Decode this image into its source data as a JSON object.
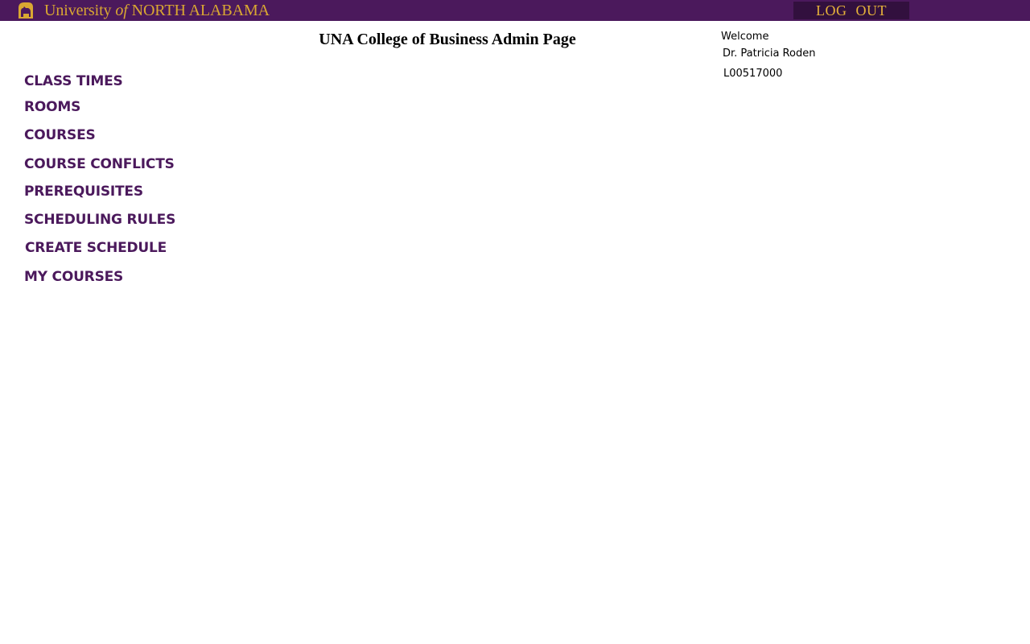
{
  "header": {
    "logo_text_1": "University",
    "logo_text_of": "of",
    "logo_text_2": "NORTH ALABAMA",
    "logo_icon": "lion-icon",
    "logout_label": "LOG  OUT",
    "colors": {
      "bar": "#4b195c",
      "gold": "#d9a732",
      "logout_bg": "#32103e"
    }
  },
  "main": {
    "title": "UNA College of Business Admin Page"
  },
  "user": {
    "welcome": "Welcome",
    "name": "Dr. Patricia Roden",
    "id": "L00517000"
  },
  "nav": {
    "items": [
      "CLASS TIMES",
      "ROOMS",
      "COURSES",
      "COURSE CONFLICTS",
      "PREREQUISITES",
      "SCHEDULING RULES",
      "CREATE SCHEDULE",
      "MY COURSES"
    ]
  }
}
